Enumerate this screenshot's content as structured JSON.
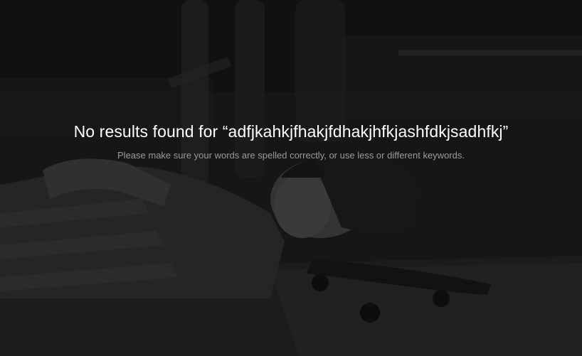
{
  "search": {
    "prefix": "No results found for ",
    "query": "“adfjkahkjfhakjfdhakjhfkjashfdkjsadhfkj”"
  },
  "help_text": "Please make sure your words are spelled correctly, or use less or different keywords.",
  "colors": {
    "headline": "#ffffff",
    "subtext": "#9a9a9a",
    "background": "#1a1a1a"
  }
}
